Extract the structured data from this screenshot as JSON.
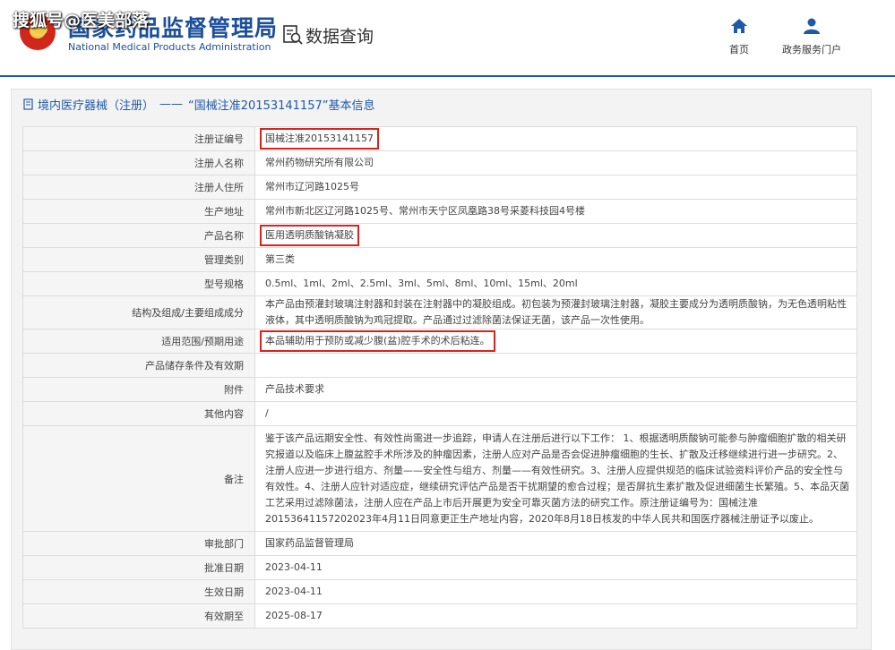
{
  "watermark": "搜狐号@医美部落",
  "header": {
    "logo_cn": "国家药品监督管理局",
    "logo_en": "National Medical Products Administration",
    "search_label": "数据查询",
    "nav": [
      {
        "label": "首页",
        "icon": "home-icon"
      },
      {
        "label": "政务服务门户",
        "icon": "user-icon"
      }
    ]
  },
  "panel": {
    "title_prefix": "境内医疗器械（注册）",
    "title_sep": "——",
    "title_main": "“国械注准20153141157”基本信息"
  },
  "rows": [
    {
      "label": "注册证编号",
      "value": "国械注准20153141157"
    },
    {
      "label": "注册人名称",
      "value": "常州药物研究所有限公司"
    },
    {
      "label": "注册人住所",
      "value": "常州市辽河路1025号"
    },
    {
      "label": "生产地址",
      "value": "常州市新北区辽河路1025号、常州市天宁区凤凰路38号采菱科技园4号楼"
    },
    {
      "label": "产品名称",
      "value": "医用透明质酸钠凝胶"
    },
    {
      "label": "管理类别",
      "value": "第三类"
    },
    {
      "label": "型号规格",
      "value": "0.5ml、1ml、2ml、2.5ml、3ml、5ml、8ml、10ml、15ml、20ml"
    },
    {
      "label": "结构及组成/主要组成成分",
      "value": "本产品由预灌封玻璃注射器和封装在注射器中的凝胶组成。初包装为预灌封玻璃注射器，凝胶主要成分为透明质酸钠，为无色透明粘性液体，其中透明质酸钠为鸡冠提取。产品通过过滤除菌法保证无菌，该产品一次性使用。"
    },
    {
      "label": "适用范围/预期用途",
      "value": "本品辅助用于预防或减少腹(盆)腔手术的术后粘连。"
    },
    {
      "label": "产品储存条件及有效期",
      "value": ""
    },
    {
      "label": "附件",
      "value": "产品技术要求"
    },
    {
      "label": "其他内容",
      "value": "/"
    },
    {
      "label": "备注",
      "value": "鉴于该产品远期安全性、有效性尚需进一步追踪，申请人在注册后进行以下工作： 1、根据透明质酸钠可能参与肿瘤细胞扩散的相关研究报道以及临床上腹盆腔手术所涉及的肿瘤因素，注册人应对产品是否会促进肿瘤细胞的生长、扩散及迁移继续进行进一步研究。2、注册人应进一步进行组方、剂量——安全性与组方、剂量——有效性研究。3、注册人应提供规范的临床试验资料评价产品的安全性与有效性。4、注册人应针对适应症，继续研究评估产品是否干扰期望的愈合过程；是否屏抗生素扩散及促进细菌生长繁殖。5、本品灭菌工艺采用过滤除菌法，注册人应在产品上市后开展更为安全可靠灭菌方法的研究工作。原注册证编号为：国械注准20153641157202023年4月11日同意更正生产地址内容，2020年8月18日核发的中华人民共和国医疗器械注册证予以废止。"
    },
    {
      "label": "审批部门",
      "value": "国家药品监督管理局"
    },
    {
      "label": "批准日期",
      "value": "2023-04-11"
    },
    {
      "label": "生效日期",
      "value": "2023-04-11"
    },
    {
      "label": "有效期至",
      "value": "2025-08-17"
    }
  ],
  "colors": {
    "accent": "#1f5aa8",
    "highlight": "#d9231c"
  }
}
